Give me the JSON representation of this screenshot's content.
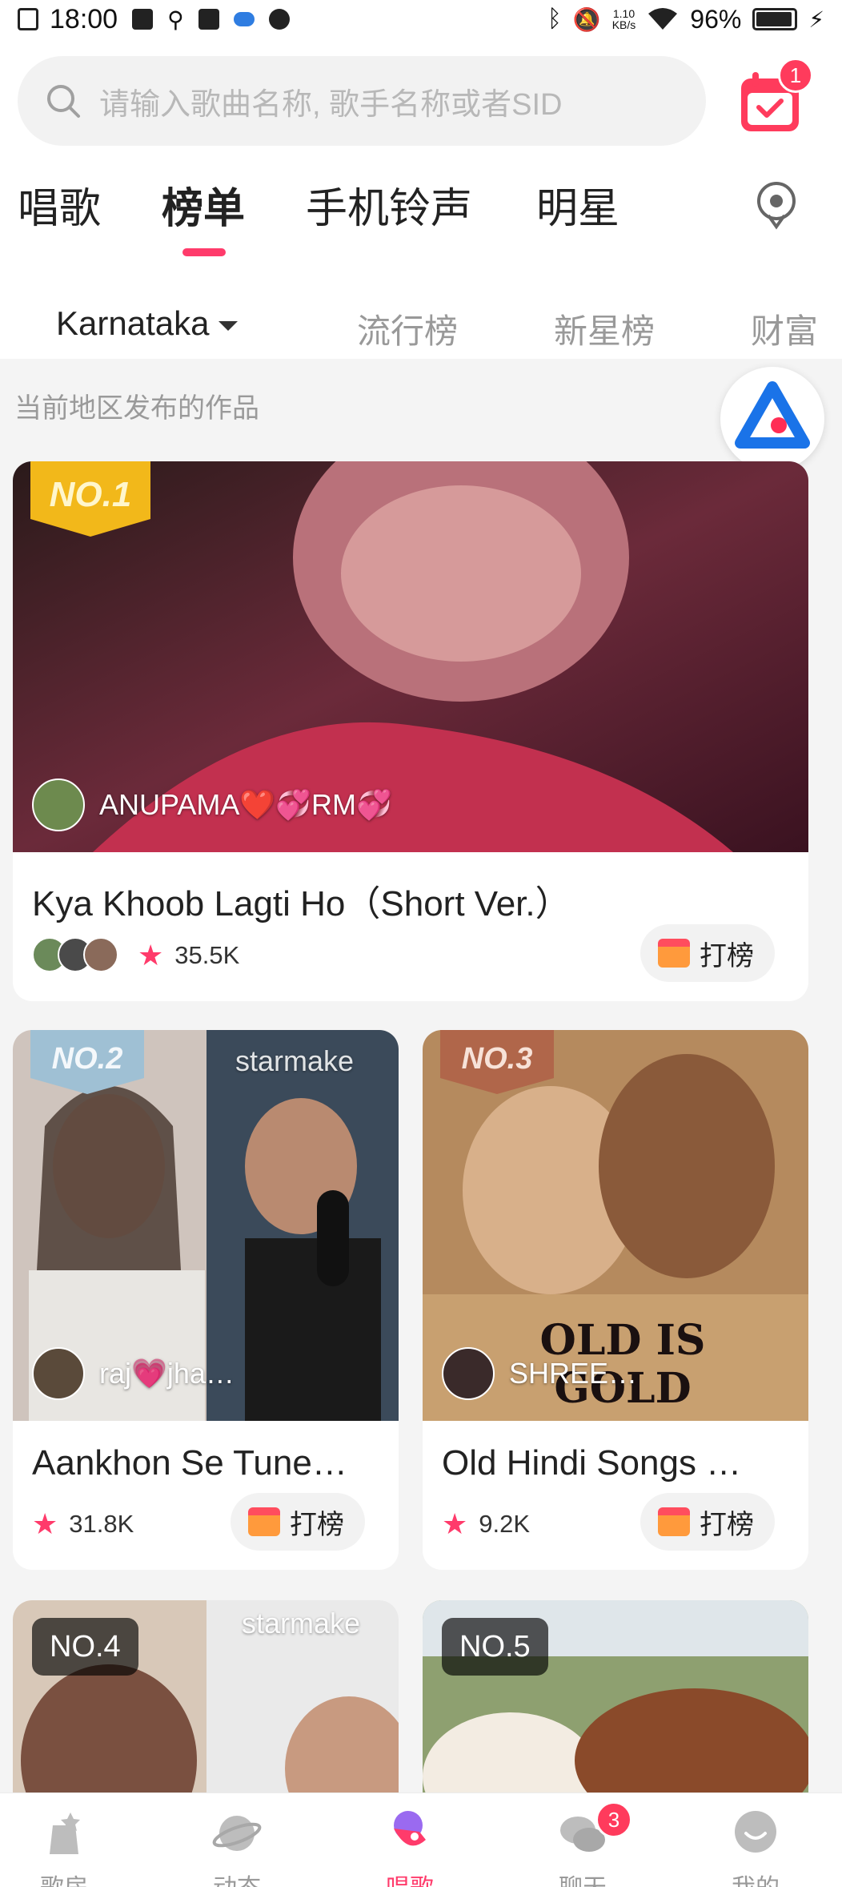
{
  "status_bar": {
    "time": "18:00",
    "net_speed_value": "1.10",
    "net_speed_unit": "KB/s",
    "battery": "96%"
  },
  "search": {
    "placeholder": "请输入歌曲名称, 歌手名称或者SID"
  },
  "calendar_badge": "1",
  "tabs": [
    {
      "label": "唱歌"
    },
    {
      "label": "榜单"
    },
    {
      "label": "手机铃声"
    },
    {
      "label": "明星"
    }
  ],
  "subtabs": [
    {
      "label": "Karnataka"
    },
    {
      "label": "流行榜"
    },
    {
      "label": "新星榜"
    },
    {
      "label": "财富"
    }
  ],
  "section_label": "当前地区发布的作品",
  "cards": [
    {
      "rank": "NO.1",
      "user": "ANUPAMA❤️💞RM💞",
      "title": "Kya Khoob Lagti Ho（Short Ver.）",
      "count": "35.5K",
      "button": "打榜"
    },
    {
      "rank": "NO.2",
      "user": "raj💗jha…",
      "title": "Aankhon Se Tune…",
      "count": "31.8K",
      "button": "打榜",
      "watermark": "starmake"
    },
    {
      "rank": "NO.3",
      "user": "SHREE…",
      "title": "Old Hindi Songs …",
      "count": "9.2K",
      "button": "打榜",
      "overlay_text": "OLD IS GOLD"
    },
    {
      "rank": "NO.4",
      "watermark": "starmake"
    },
    {
      "rank": "NO.5"
    }
  ],
  "bottom_nav": [
    {
      "label": "歌房"
    },
    {
      "label": "动态"
    },
    {
      "label": "唱歌"
    },
    {
      "label": "聊天",
      "badge": "3"
    },
    {
      "label": "我的"
    }
  ]
}
